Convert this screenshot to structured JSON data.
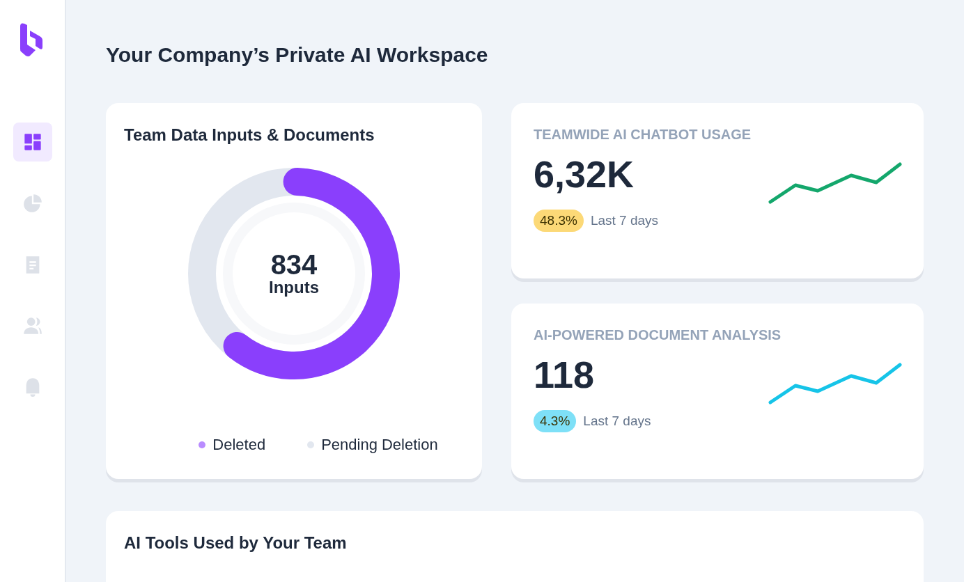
{
  "sidebar": {
    "items": [
      {
        "selected": true
      },
      {
        "selected": false
      },
      {
        "selected": false
      },
      {
        "selected": false
      },
      {
        "selected": false
      }
    ]
  },
  "page": {
    "title": "Your Company’s Private AI Workspace"
  },
  "donut_card": {
    "title": "Team Data Inputs & Documents",
    "value": "834",
    "unit": "Inputs",
    "legend": [
      {
        "label": "Deleted",
        "color": "#b98cff"
      },
      {
        "label": "Pending Deletion",
        "color": "#e2e7ef"
      }
    ]
  },
  "stat_cards": [
    {
      "title": "TEAMWIDE AI CHATBOT USAGE",
      "value": "6,32K",
      "badge": "48.3%",
      "color": "#fcd977",
      "period": "Last 7 days"
    },
    {
      "title": "AI-POWERED DOCUMENT ANALYSIS",
      "value": "118",
      "badge": "4.3%",
      "color": "#7ee0f7",
      "period": "Last 7 days"
    }
  ],
  "tools_card": {
    "title": "AI Tools Used by Your Team"
  }
}
